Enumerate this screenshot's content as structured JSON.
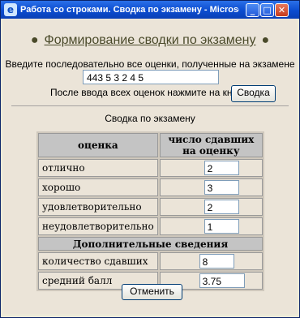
{
  "window": {
    "title": "Работа со строками. Сводка по экзамену - Microsoft In..."
  },
  "heading": {
    "text": "Формирование сводки по экзамену"
  },
  "input": {
    "instruction": "Введите последовательно все оценки, полученные на экзамене",
    "grades_value": "443 5  3 2 4 5",
    "after_text": "После ввода всех оценок нажмите на кнопку",
    "summary_button": "Сводка"
  },
  "summary": {
    "caption": "Сводка по экзамену",
    "col_grade": "оценка",
    "col_count": "число сдавших на оценку",
    "rows": [
      {
        "label": "отлично",
        "value": "2"
      },
      {
        "label": "хорошо",
        "value": "3"
      },
      {
        "label": "удовлетворительно",
        "value": "2"
      },
      {
        "label": "неудовлетворительно",
        "value": "1"
      }
    ],
    "extra_header": "Дополнительные сведения",
    "extra_rows": [
      {
        "label": "количество сдавших",
        "value": "8"
      },
      {
        "label": "средний балл",
        "value": "3.75"
      }
    ]
  },
  "cancel_button": "Отменить"
}
